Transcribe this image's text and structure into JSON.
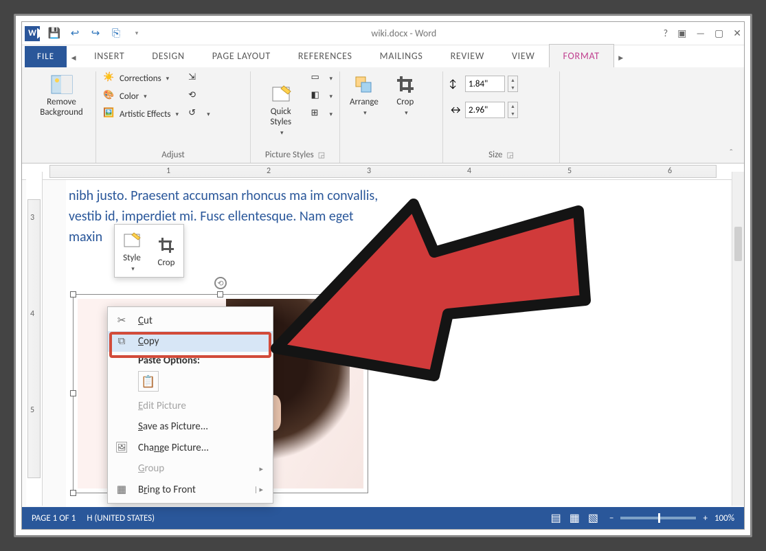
{
  "title": "wiki.docx - Word",
  "qat": {
    "save": "💾",
    "undo": "↩",
    "redo": "↪",
    "custom": "⎘"
  },
  "tabs": {
    "file": "FILE",
    "list": [
      "INSERT",
      "DESIGN",
      "PAGE LAYOUT",
      "REFERENCES",
      "MAILINGS",
      "REVIEW",
      "VIEW"
    ],
    "active": "FORMAT"
  },
  "ribbon": {
    "remove_bg": "Remove Background",
    "adjust": {
      "label": "Adjust",
      "corrections": "Corrections",
      "color": "Color",
      "artistic": "Artistic Effects"
    },
    "pstyles": {
      "label": "Picture Styles",
      "quick": "Quick Styles"
    },
    "arrange": {
      "label": "Arrange",
      "btn": "Arrange",
      "crop": "Crop"
    },
    "size": {
      "label": "Size",
      "h": "1.84\"",
      "w": "2.96\""
    }
  },
  "ruler": {
    "marks": [
      "1",
      "2",
      "3",
      "4",
      "5",
      "6"
    ],
    "vmarks": [
      "3",
      "4",
      "5"
    ]
  },
  "body_lines": [
    "nibh justo. Praesent accumsan rhoncus ma                                         im convallis,",
    "vestib                id, imperdiet mi. Fusc                                         ellentesque. Nam eget",
    "maxin"
  ],
  "minitool": {
    "style": "Style",
    "crop": "Crop"
  },
  "ctx": {
    "cut": "Cut",
    "copy": "Copy",
    "paste_hdr": "Paste Options:",
    "edit": "Edit Picture",
    "saveas": "Save as Picture...",
    "change": "Change Picture...",
    "group": "Group",
    "bring": "Bring to Front"
  },
  "status": {
    "page": "PAGE 1 OF 1",
    "lang": "H (UNITED STATES)",
    "zoom": "100%"
  }
}
